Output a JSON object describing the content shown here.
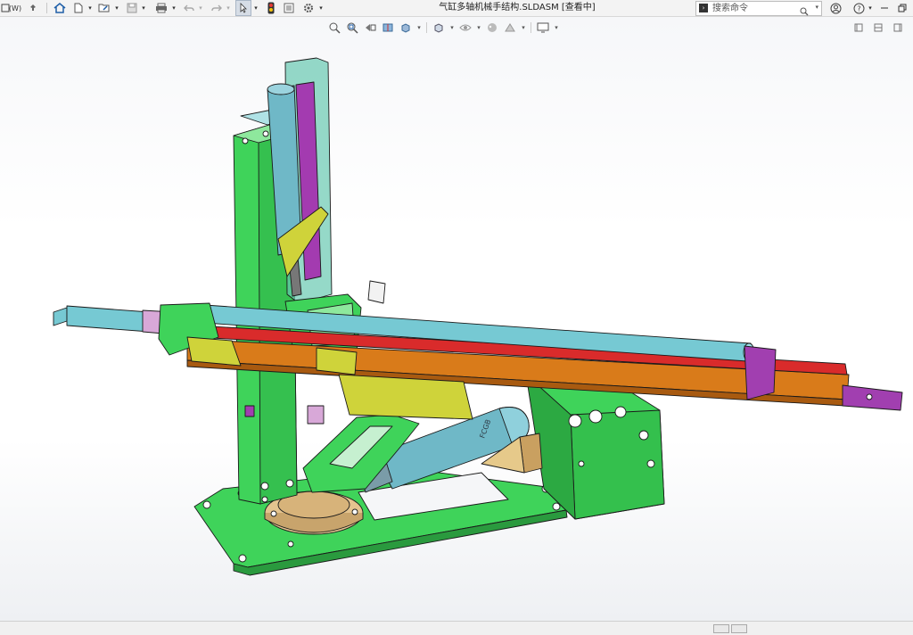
{
  "app": {
    "menu_label": "(W)",
    "document_title": "气缸多轴机械手结构.SLDASM [查看中]"
  },
  "search": {
    "placeholder": "搜索命令"
  },
  "toolbar_icons": [
    "pin-icon",
    "home-icon",
    "new-file-icon",
    "open-file-icon",
    "save-icon",
    "print-icon",
    "undo-icon",
    "redo-icon",
    "select-arrow-icon",
    "traffic-light-icon",
    "options-icon",
    "gear-icon"
  ],
  "view_toolbar_icons": [
    "zoom-to-fit-icon",
    "zoom-area-icon",
    "previous-view-icon",
    "section-view-icon",
    "view-orientation-icon",
    "display-style-icon",
    "hide-show-icon",
    "edit-appearance-icon",
    "apply-scene-icon",
    "view-settings-icon"
  ],
  "model_text": {
    "cylinder_label": "FCGB"
  },
  "colors": {
    "frame_green": "#3fd35a",
    "rail_red": "#d92b2b",
    "rail_orange": "#d97b1a",
    "rod_cyan": "#76c9d3",
    "bracket_yellow": "#cfd33a",
    "clamp_purple": "#a13fb0",
    "base_gold": "#e4c48f"
  }
}
